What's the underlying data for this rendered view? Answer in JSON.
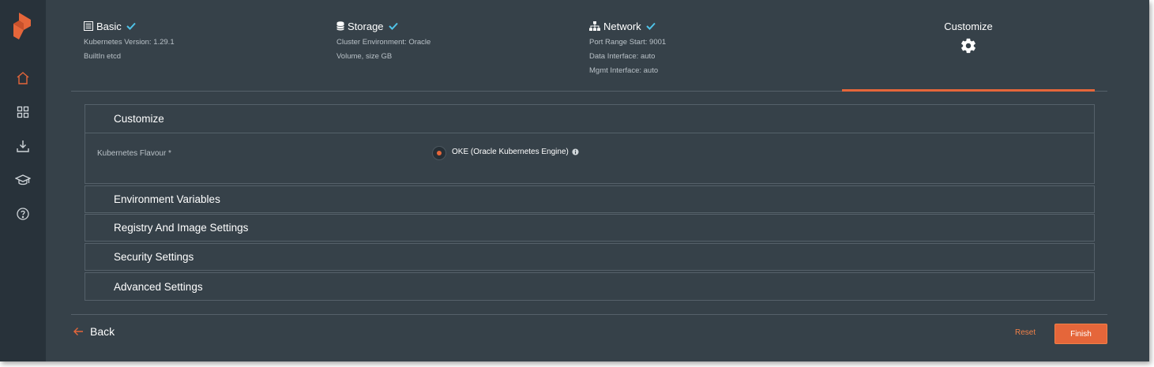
{
  "colors": {
    "accent": "#e5663a",
    "check": "#4fc3e8",
    "background": "#364149",
    "sidebar": "#28323a"
  },
  "sidebar": {
    "items": [
      {
        "icon": "home-icon"
      },
      {
        "icon": "apps-grid-icon"
      },
      {
        "icon": "download-icon"
      },
      {
        "icon": "graduation-cap-icon"
      },
      {
        "icon": "help-circle-icon"
      }
    ]
  },
  "steps": [
    {
      "title": "Basic",
      "icon": "list-icon",
      "complete": true,
      "info": [
        "Kubernetes Version: 1.29.1",
        "BuiltIn etcd"
      ]
    },
    {
      "title": "Storage",
      "icon": "database-icon",
      "complete": true,
      "info": [
        "Cluster Environment: Oracle",
        "Volume, size GB"
      ]
    },
    {
      "title": "Network",
      "icon": "network-icon",
      "complete": true,
      "info": [
        "Port Range Start: 9001",
        "Data Interface: auto",
        "Mgmt Interface: auto"
      ]
    },
    {
      "title": "Customize",
      "icon": "gear-icon",
      "active": true
    }
  ],
  "customize": {
    "title": "Customize",
    "field_label": "Kubernetes Flavour *",
    "option_label": "OKE (Oracle Kubernetes Engine)",
    "selected": true
  },
  "sections": [
    "Environment Variables",
    "Registry And Image Settings",
    "Security Settings",
    "Advanced Settings"
  ],
  "footer": {
    "back_label": "Back",
    "reset_label": "Reset",
    "finish_label": "Finish"
  }
}
